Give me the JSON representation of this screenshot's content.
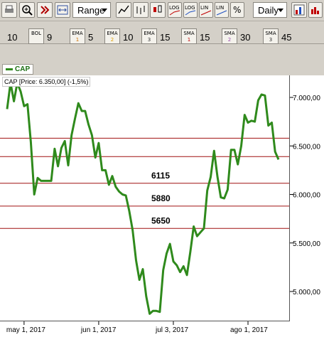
{
  "toolbar": {
    "range_label": "Range",
    "period_label": "Daily",
    "zoom_value": "10",
    "indicators": [
      {
        "name": "BOL",
        "sub": "",
        "value": "9"
      },
      {
        "name": "EMA",
        "sub": "1",
        "value": "5"
      },
      {
        "name": "EMA",
        "sub": "2",
        "value": "10"
      },
      {
        "name": "EMA",
        "sub": "3",
        "value": "15"
      },
      {
        "name": "SMA",
        "sub": "1",
        "value": "15"
      },
      {
        "name": "SMA",
        "sub": "2",
        "value": "30"
      },
      {
        "name": "SMA",
        "sub": "3",
        "value": "45"
      }
    ],
    "scale_buttons": [
      "LOG",
      "LOG",
      "LIN",
      "LIN",
      "%"
    ],
    "colors": {
      "line": "#2f8a1c",
      "hline": "#a01010"
    }
  },
  "legend": {
    "symbol": "CAP"
  },
  "price_label": "CAP [Price: 6.350,00] (-1,5%)",
  "chart_data": {
    "type": "line",
    "title": "",
    "xlabel": "",
    "ylabel": "",
    "ylim": [
      4750,
      7250
    ],
    "yticks": [
      5000,
      5500,
      6000,
      6500,
      7000
    ],
    "ytick_labels": [
      "5.000,00",
      "5.500,00",
      "6.000,00",
      "6.500,00",
      "7.000,00"
    ],
    "xticks": [
      {
        "index": 5,
        "label": "may 1, 2017"
      },
      {
        "index": 27,
        "label": "jun 1, 2017"
      },
      {
        "index": 49,
        "label": "jul 3, 2017"
      },
      {
        "index": 71,
        "label": "ago 1, 2017"
      }
    ],
    "hlines": [
      {
        "value": 6580,
        "label": ""
      },
      {
        "value": 6390,
        "label": ""
      },
      {
        "value": 6115,
        "label": "6115"
      },
      {
        "value": 5880,
        "label": "5880"
      },
      {
        "value": 5650,
        "label": "5650"
      }
    ],
    "series": [
      {
        "values": [
          6880,
          7150,
          6960,
          7150,
          7060,
          6910,
          6930,
          6540,
          6000,
          6170,
          6140,
          6140,
          6140,
          6140,
          6470,
          6290,
          6480,
          6550,
          6300,
          6610,
          6780,
          6940,
          6860,
          6860,
          6720,
          6610,
          6380,
          6530,
          6250,
          6250,
          6100,
          6190,
          6080,
          6030,
          6000,
          5990,
          5830,
          5630,
          5320,
          5120,
          5230,
          4950,
          4770,
          4800,
          4800,
          4790,
          5220,
          5390,
          5490,
          5310,
          5270,
          5200,
          5260,
          5170,
          5410,
          5670,
          5570,
          5610,
          5650,
          6040,
          6180,
          6450,
          6180,
          5970,
          5960,
          6050,
          6460,
          6460,
          6310,
          6500,
          6820,
          6740,
          6760,
          6750,
          6970,
          7030,
          7020,
          6710,
          6740,
          6440,
          6360
        ]
      }
    ]
  }
}
